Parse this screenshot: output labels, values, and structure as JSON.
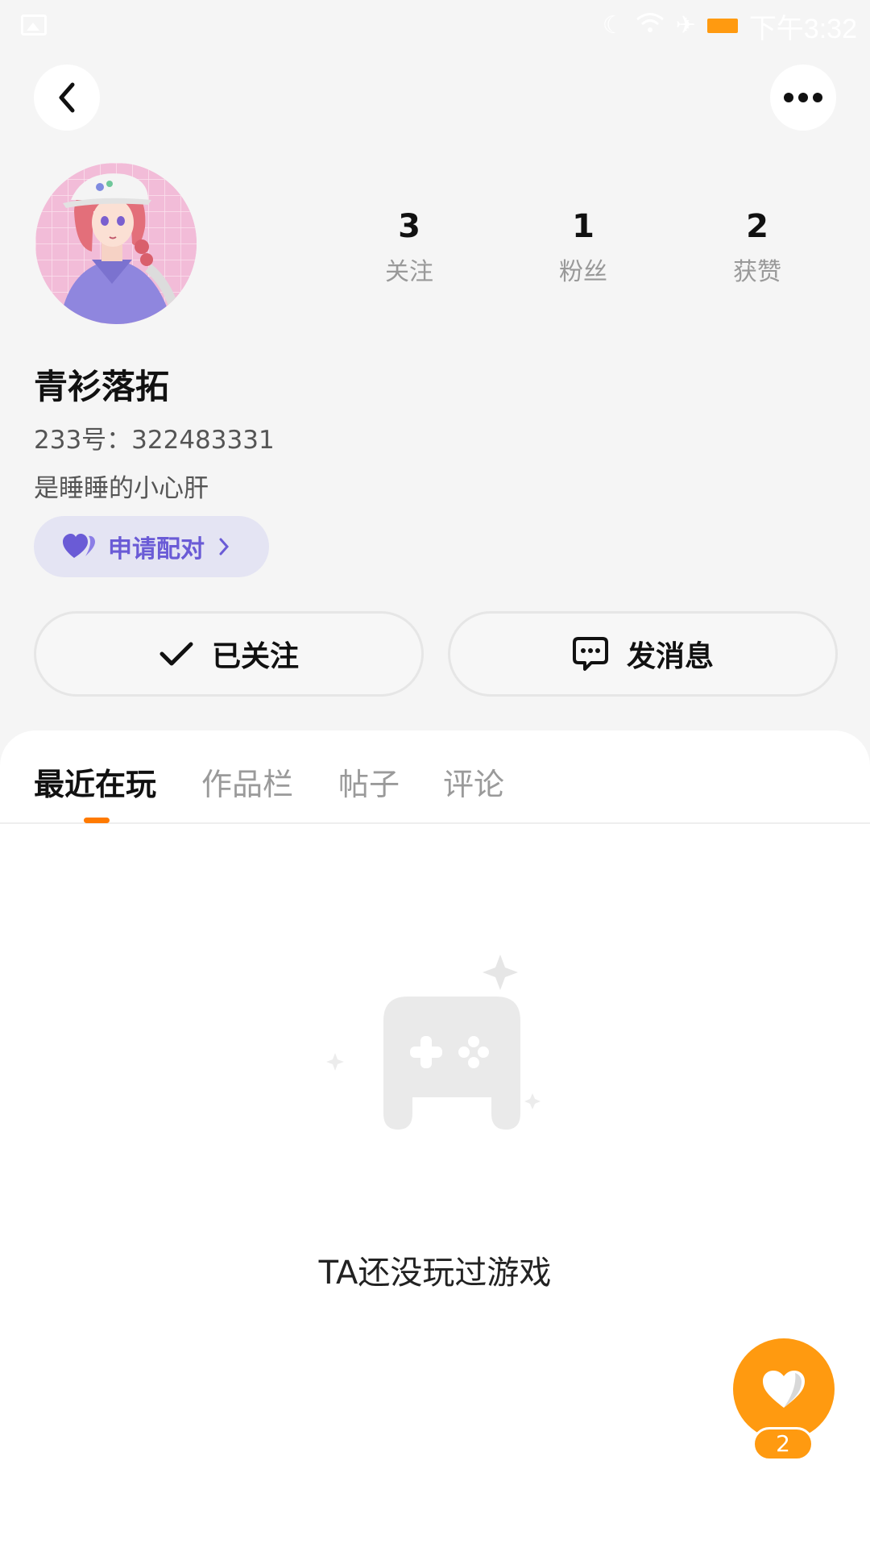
{
  "status_bar": {
    "time": "下午3:32",
    "icons": [
      "image-icon",
      "moon-icon",
      "wifi-icon",
      "airplane-icon",
      "battery-icon"
    ]
  },
  "header": {
    "back_icon": "chevron-left-icon",
    "more_icon": "more-dots-icon"
  },
  "profile": {
    "username": "青衫落拓",
    "user_id": "233号：322483331",
    "bio": "是睡睡的小心肝",
    "pair_button_label": "申请配对",
    "stats": [
      {
        "value": "3",
        "label": "关注"
      },
      {
        "value": "1",
        "label": "粉丝"
      },
      {
        "value": "2",
        "label": "获赞"
      }
    ]
  },
  "actions": {
    "follow_label": "已关注",
    "message_label": "发消息"
  },
  "tabs": [
    {
      "label": "最近在玩",
      "active": true
    },
    {
      "label": "作品栏",
      "active": false
    },
    {
      "label": "帖子",
      "active": false
    },
    {
      "label": "评论",
      "active": false
    }
  ],
  "empty_state": {
    "text": "TA还没玩过游戏",
    "icon": "gamepad-icon"
  },
  "like_fab": {
    "count": "2",
    "icon": "heart-icon"
  },
  "colors": {
    "accent_orange": "#ff9a10",
    "tab_indicator": "#ff7a00",
    "pair_purple": "#6a5bd6",
    "pair_bg": "#e4e4f3"
  }
}
